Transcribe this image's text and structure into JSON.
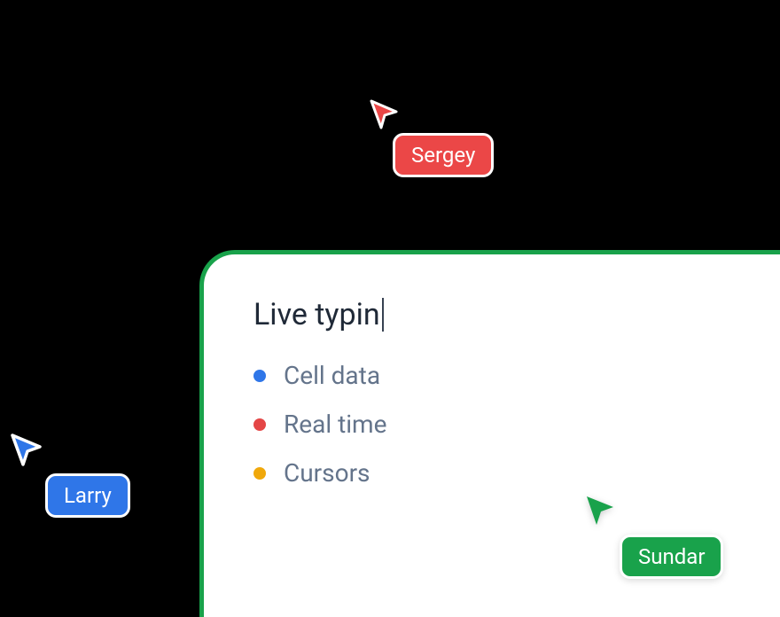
{
  "panel": {
    "typing_text": "Live typin",
    "items": [
      {
        "label": "Cell data",
        "color": "#2f76e8"
      },
      {
        "label": "Real time",
        "color": "#e44646"
      },
      {
        "label": "Cursors",
        "color": "#f0a80b"
      }
    ]
  },
  "cursors": {
    "sergey": {
      "name": "Sergey",
      "color": "#eb4747"
    },
    "larry": {
      "name": "Larry",
      "color": "#2f76e8"
    },
    "sundar": {
      "name": "Sundar",
      "color": "#19a24b"
    }
  },
  "colors": {
    "panel_border": "#19a24b",
    "text_primary": "#1f2937",
    "text_secondary": "#64748b"
  }
}
